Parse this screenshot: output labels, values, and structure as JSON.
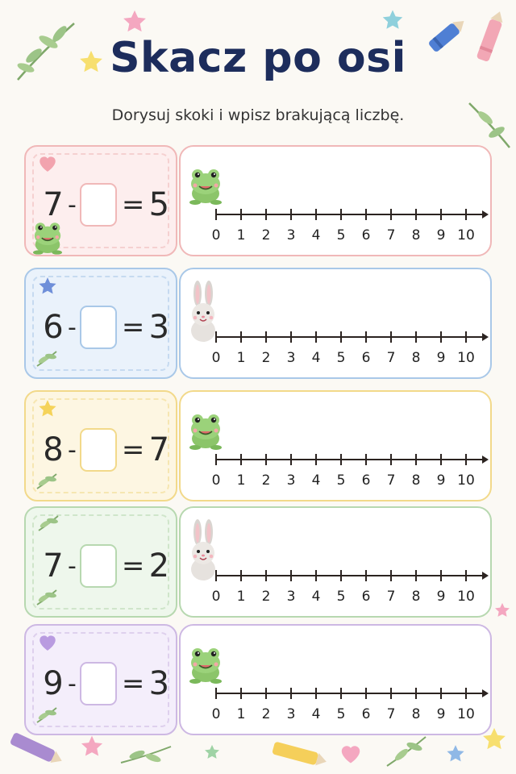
{
  "title": "Skacz po osi",
  "instruction": "Dorysuj skoki i wpisz brakującą liczbę.",
  "tick_labels": [
    "0",
    "1",
    "2",
    "3",
    "4",
    "5",
    "6",
    "7",
    "8",
    "9",
    "10"
  ],
  "exercises": [
    {
      "minuend": "7",
      "minus": "-",
      "equals": "=",
      "result": "5",
      "animal": "frog",
      "color": "#f0b8b8",
      "bg": "#fdeeee",
      "corner_icon": "heart-icon"
    },
    {
      "minuend": "6",
      "minus": "-",
      "equals": "=",
      "result": "3",
      "animal": "bunny",
      "color": "#a9c8e8",
      "bg": "#eaf2fb",
      "corner_icon": "star-icon"
    },
    {
      "minuend": "8",
      "minus": "-",
      "equals": "=",
      "result": "7",
      "animal": "frog",
      "color": "#f2d98a",
      "bg": "#fdf6e2",
      "corner_icon": "star-icon"
    },
    {
      "minuend": "7",
      "minus": "-",
      "equals": "=",
      "result": "2",
      "animal": "bunny",
      "color": "#b7d8b0",
      "bg": "#eef7ec",
      "corner_icon": "leaf-icon"
    },
    {
      "minuend": "9",
      "minus": "-",
      "equals": "=",
      "result": "3",
      "animal": "frog",
      "color": "#cdb8e3",
      "bg": "#f4eefb",
      "corner_icon": "heart-icon"
    }
  ],
  "colors": {
    "title": "#1d2d5c",
    "axis": "#2b2320"
  }
}
